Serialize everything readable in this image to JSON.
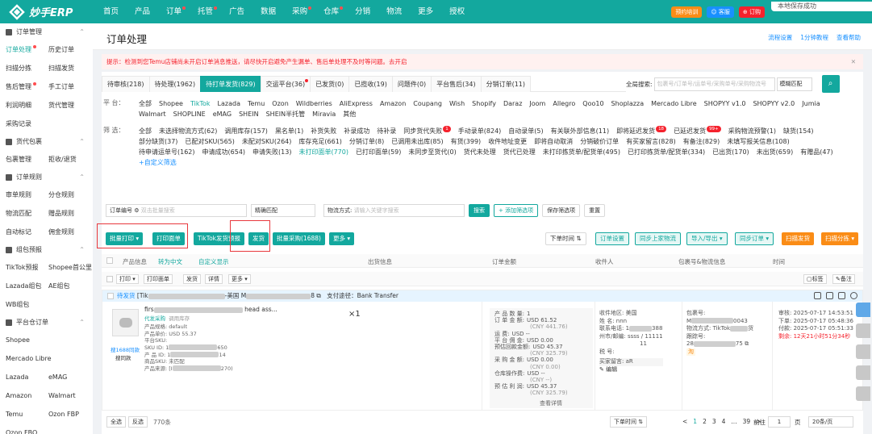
{
  "topbar": {
    "logo": "妙手ERP",
    "nav": [
      {
        "label": "首页",
        "dot": false
      },
      {
        "label": "产品",
        "dot": false
      },
      {
        "label": "订单",
        "dot": true
      },
      {
        "label": "托管",
        "dot": true
      },
      {
        "label": "广告",
        "dot": false
      },
      {
        "label": "数据",
        "dot": false
      },
      {
        "label": "采购",
        "dot": true
      },
      {
        "label": "仓库",
        "dot": true
      },
      {
        "label": "分销",
        "dot": false
      },
      {
        "label": "物流",
        "dot": false
      },
      {
        "label": "更多",
        "dot": false
      },
      {
        "label": "授权",
        "dot": false
      }
    ],
    "btn_booking": "预约培训",
    "btn_service": "客服",
    "btn_order": "订购",
    "tip": "本地保存成功"
  },
  "sidebar": {
    "groups": [
      {
        "title": "订单管理",
        "rows": [
          [
            "订单处理",
            "历史订单"
          ],
          [
            "扫描分拣",
            "扫描发货"
          ],
          [
            "售后管理",
            "手工订单"
          ],
          [
            "利润明细",
            "货代管理"
          ],
          [
            "采购记录",
            ""
          ]
        ]
      },
      {
        "title": "货代包裹",
        "rows": [
          [
            "包裹管理",
            "拒收/退货"
          ]
        ]
      },
      {
        "title": "订单规则",
        "rows": [
          [
            "审单规则",
            "分仓规则"
          ],
          [
            "物流匹配",
            "赠品规则"
          ],
          [
            "自动标记",
            "佣金规则"
          ]
        ]
      },
      {
        "title": "组包预报",
        "rows": [
          [
            "TikTok预报",
            "Shopee首公里"
          ],
          [
            "Lazada组包",
            "AE组包"
          ],
          [
            "WB组包",
            ""
          ]
        ]
      },
      {
        "title": "平台仓订单",
        "rows": [
          [
            "Shopee",
            ""
          ],
          [
            "Mercado Libre",
            ""
          ],
          [
            "Lazada",
            "eMAG"
          ],
          [
            "Amazon",
            "Walmart"
          ],
          [
            "Temu",
            "Ozon FBP"
          ],
          [
            "Ozon FBO",
            ""
          ]
        ]
      }
    ]
  },
  "page": {
    "title": "订单处理",
    "links": [
      "流程设置",
      "1分钟教程",
      "查看帮助"
    ],
    "notice": "提示：检测到您Temu店铺尚未开启订单消息推送，请尽快开启避免产生漏单、售后单处理不及时等问题。去开启"
  },
  "tabs": [
    {
      "label": "待审核(218)",
      "active": false,
      "dot": false
    },
    {
      "label": "待处理(1962)",
      "active": false,
      "dot": false
    },
    {
      "label": "待打单发货(829)",
      "active": true,
      "dot": false
    },
    {
      "label": "交运平台(36)",
      "active": false,
      "dot": true
    },
    {
      "label": "已发货(0)",
      "active": false,
      "dot": false
    },
    {
      "label": "已揽收(19)",
      "active": false,
      "dot": false
    },
    {
      "label": "问题件(0)",
      "active": false,
      "dot": false
    },
    {
      "label": "平台售后(34)",
      "active": false,
      "dot": false
    },
    {
      "label": "分销订单(11)",
      "active": false,
      "dot": false
    }
  ],
  "global_search": {
    "label": "全局搜索:",
    "placeholder": "包裹号/订单号/运单号/采购单号/采购物流号",
    "mode": "模糊匹配"
  },
  "platform_filter": {
    "label": "平 台：",
    "options": [
      "全部",
      "Shopee",
      "TikTok",
      "Lazada",
      "Temu",
      "Ozon",
      "Wildberries",
      "AliExpress",
      "Amazon",
      "Coupang",
      "Wish",
      "Shopify",
      "Daraz",
      "Joom",
      "Allegro",
      "Qoo10",
      "Shoplazza",
      "Mercado Libre",
      "SHOPYY v1.0",
      "SHOPYY v2.0",
      "Jumia",
      "Walmart",
      "SHOPLINE",
      "eMAG",
      "SHEIN",
      "SHEIN半托管",
      "Miravia",
      "其他"
    ],
    "active": "TikTok"
  },
  "filter2": {
    "label": "筛 选：",
    "options": [
      {
        "t": "全部"
      },
      {
        "t": "未选择物流方式(62)"
      },
      {
        "t": "调用库存(157)"
      },
      {
        "t": "黑名单(1)"
      },
      {
        "t": "补货失败"
      },
      {
        "t": "补录成功"
      },
      {
        "t": "待补录"
      },
      {
        "t": "同步货代失败",
        "badge": "1"
      },
      {
        "t": "手动录单(824)"
      },
      {
        "t": "自动录单(5)"
      },
      {
        "t": "有关联外部信息(11)"
      },
      {
        "t": "即将延迟发货",
        "badge": "18"
      },
      {
        "t": "已延迟发货",
        "badge": "99+"
      },
      {
        "t": "采购物流预警(1)"
      },
      {
        "t": "缺货(154)"
      },
      {
        "t": "部分缺货(37)"
      },
      {
        "t": "已配对SKU(565)"
      },
      {
        "t": "未配对SKU(264)"
      },
      {
        "t": "库存充足(661)"
      },
      {
        "t": "分销订单(8)"
      },
      {
        "t": "已调用未出库(85)"
      },
      {
        "t": "有货(399)"
      },
      {
        "t": "收件地址变更"
      },
      {
        "t": "即将自动取消"
      },
      {
        "t": "分销破价订单"
      },
      {
        "t": "有买家留言(828)"
      },
      {
        "t": "有备注(829)"
      },
      {
        "t": "未填写报关信息(108)"
      },
      {
        "t": "待申请运单号(162)"
      },
      {
        "t": "申请成功(654)"
      },
      {
        "t": "申请失败(13)"
      },
      {
        "t": "未打印面单(770)",
        "active": true
      },
      {
        "t": "已打印面单(59)"
      },
      {
        "t": "未同步至货代(0)"
      },
      {
        "t": "货代未处理"
      },
      {
        "t": "货代已处理"
      },
      {
        "t": "未打印拣货单/配货单(495)"
      },
      {
        "t": "已打印拣货单/配货单(334)"
      },
      {
        "t": "已出货(170)"
      },
      {
        "t": "未出货(659)"
      },
      {
        "t": "有赠品(47)"
      },
      {
        "t": "+自定义筛选",
        "link": true
      }
    ]
  },
  "search_row": {
    "order_no_label": "订单编号",
    "order_no_placeholder": "双击批量搜索",
    "match": "精确匹配",
    "logistics_label": "物流方式:",
    "logistics_placeholder": "请输入关键字搜索",
    "search": "搜索",
    "add_filter": "+ 添加筛选项",
    "save_filter": "保存筛选项",
    "reset": "重置"
  },
  "actions": {
    "batch_print": "批量打印",
    "print_label": "打印面单",
    "tiktok_forecast": "TikTok发货预报",
    "ship": "发货",
    "batch_purchase": "批量采购(1688)",
    "more": "更多",
    "sort": "下单时间",
    "order_settings": "订单设置",
    "sync_logistics": "同步上家物流",
    "import_export": "导入/导出",
    "sync_order": "同步订单",
    "scan_ship": "扫描发货",
    "scan_sort": "扫描分拣"
  },
  "table": {
    "headers": [
      "产品信息",
      "转为中文",
      "自定义显示",
      "出货信息",
      "订单金额",
      "收件人",
      "包裹号&物流信息",
      "时间"
    ],
    "tag_btn": "标签",
    "note_btn": "备注",
    "sub_actions": [
      "打印",
      "打印面单",
      "发货",
      "详情",
      "更多"
    ]
  },
  "order": {
    "status": "待发货",
    "head_prefix": "[Tik",
    "region": "-美国",
    "pay_method": "支付途径：Bank Transfer",
    "title_prefix": "firs",
    "title_suffix": "head ass...",
    "qty": "×1",
    "tag_purchase": "代发采购",
    "tag_stock": "调用库存",
    "attrs": [
      "产品规格: default",
      "产品单价: USD 55.37",
      "平台SKU:",
      "SKU ID: 1",
      "产 品 ID: 1",
      "商品SKU: 未匹配",
      "产品来源: [I"
    ],
    "sku_id_tail": "650",
    "pid_tail": "14",
    "src_tail": "270)",
    "link1688": "搜1688同款",
    "link_search": "搜同款",
    "money": [
      [
        "产 品 数 量:",
        "1",
        ""
      ],
      [
        "订 单 金 额:",
        "USD 61.52",
        "(CNY 441.76)"
      ],
      [
        "运      费:",
        "USD --",
        ""
      ],
      [
        "平 台 佣 金:",
        "USD 0.00",
        ""
      ],
      [
        "预估回款金额:",
        "USD 45.37",
        "(CNY 325.79)"
      ],
      [
        "采 购 金 额:",
        "USD 0.00",
        "(CNY 0.00)"
      ],
      [
        "仓库操作费:",
        "USD --",
        "(CNY --)"
      ],
      [
        "预 估 利 润:",
        "USD 45.37",
        "(CNY 325.79)"
      ]
    ],
    "view_detail": "查看详情",
    "recv": [
      "收件地区: 美国",
      "姓    名: nnn",
      "联系电话: 1",
      "州市/邮编: ssss / 11111",
      "11",
      "税    号:",
      "买家留言: aR",
      "编辑"
    ],
    "recv_tail": "388",
    "pack": [
      "包裹号:",
      "M",
      "物流方式: TikTok",
      "跟踪号:",
      "28"
    ],
    "pack_tail1": "0043",
    "pack_tail2": "货",
    "pack_tail3": "75",
    "pack_tag": "淘",
    "time": [
      "审核: 2025-07-17 14:53:51",
      "下单: 2025-07-17 05:48:36",
      "付款: 2025-07-17 05:51:33"
    ],
    "time_remain": "剩余: 12天21小时51分34秒"
  },
  "footer": {
    "select_all": "全选",
    "invert": "反选",
    "count": "770条",
    "sort": "下单时间",
    "pages": [
      "<",
      "1",
      "2",
      "3",
      "4",
      "...",
      "39",
      ">"
    ],
    "current": "1",
    "goto": "前往",
    "page_unit": "页",
    "page_size": "20条/页"
  }
}
